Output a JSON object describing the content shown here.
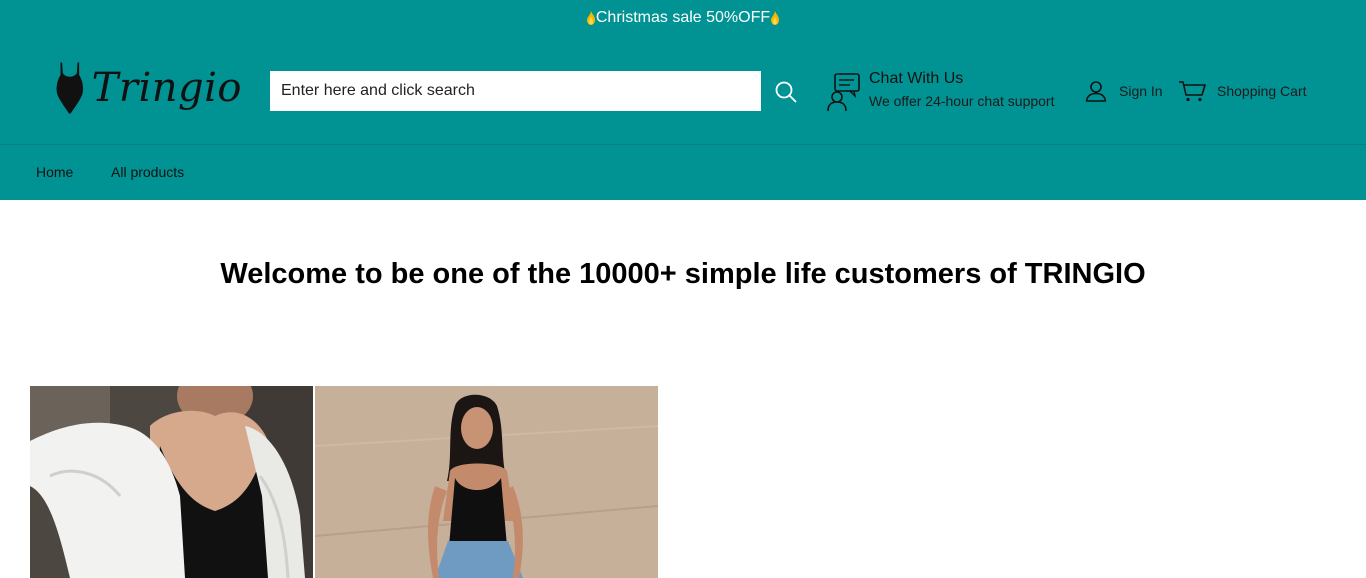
{
  "announcement": {
    "text": "Christmas sale 50%OFF"
  },
  "brand": {
    "name": "Tringio",
    "color": "#019393"
  },
  "search": {
    "placeholder": "Enter here and click search",
    "value": ""
  },
  "chat": {
    "title": "Chat With Us",
    "subtitle": "We offer 24-hour chat support"
  },
  "account": {
    "signin_label": "Sign In",
    "cart_label": "Shopping Cart"
  },
  "nav": {
    "items": [
      {
        "label": "Home"
      },
      {
        "label": "All products"
      }
    ]
  },
  "main": {
    "welcome": "Welcome to be one of the 10000+ simple life customers of TRINGIO"
  },
  "icons": [
    "flame-icon",
    "bodysuit-logo-icon",
    "search-icon",
    "chat-support-icon",
    "user-icon",
    "cart-icon"
  ]
}
